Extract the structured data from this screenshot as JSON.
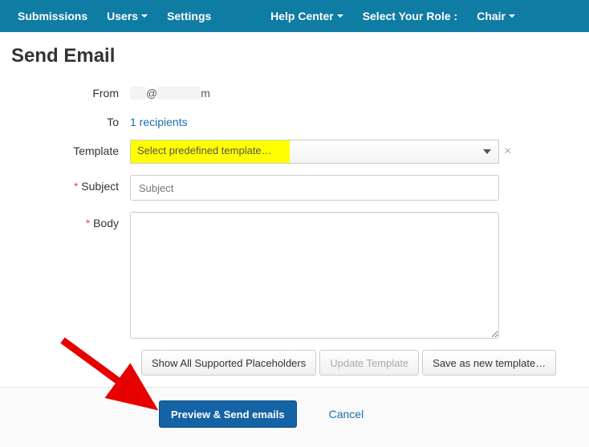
{
  "nav": {
    "submissions": "Submissions",
    "users": "Users",
    "settings": "Settings",
    "help_center": "Help Center",
    "select_role_label": "Select Your Role :",
    "role": "Chair"
  },
  "page": {
    "title": "Send Email"
  },
  "form": {
    "from_label": "From",
    "from_value": "m",
    "to_label": "To",
    "to_value": "1 recipients",
    "template_label": "Template",
    "template_placeholder": "Select predefined template…",
    "subject_label": "Subject",
    "subject_placeholder": "Subject",
    "subject_value": "",
    "body_label": "Body",
    "body_value": ""
  },
  "buttons": {
    "show_placeholders": "Show All Supported Placeholders",
    "update_template": "Update Template",
    "save_template": "Save as new template…",
    "preview_send": "Preview & Send emails",
    "cancel": "Cancel"
  }
}
